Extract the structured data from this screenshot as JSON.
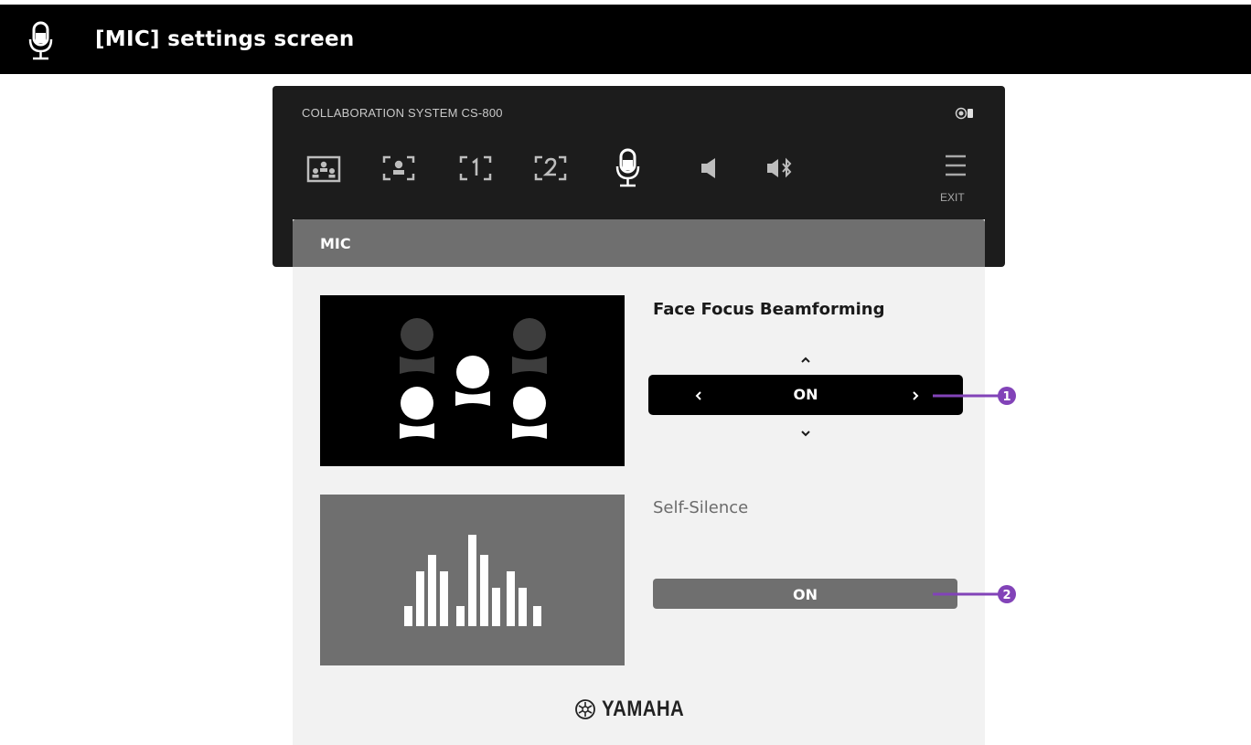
{
  "doc_header": {
    "title": "[MIC] settings screen",
    "icon": "microphone-icon"
  },
  "device": {
    "system_name": "COLLABORATION SYSTEM CS-800",
    "status_icon": "status-icon",
    "nav_icons": [
      "participants-view-icon",
      "speaker-framing-icon",
      "preset-1-icon",
      "preset-2-icon",
      "microphone-icon",
      "speaker-icon",
      "bluetooth-speaker-icon"
    ],
    "active_nav": "microphone-icon",
    "menu": {
      "icon": "menu-icon",
      "exit_label": "EXIT"
    }
  },
  "panel": {
    "title": "MIC",
    "face_focus": {
      "label": "Face Focus Beamforming",
      "value": "ON",
      "image": "face-focus-illustration"
    },
    "self_silence": {
      "label": "Self-Silence",
      "value": "ON",
      "image": "audio-level-illustration"
    },
    "logo": "YAMAHA"
  },
  "callouts": [
    "1",
    "2"
  ],
  "colors": {
    "accent_callout": "#8243b8",
    "panel_bg": "#f2f2f2",
    "header_gray": "#6f6f6f",
    "device_bar": "#1c1c1c"
  }
}
